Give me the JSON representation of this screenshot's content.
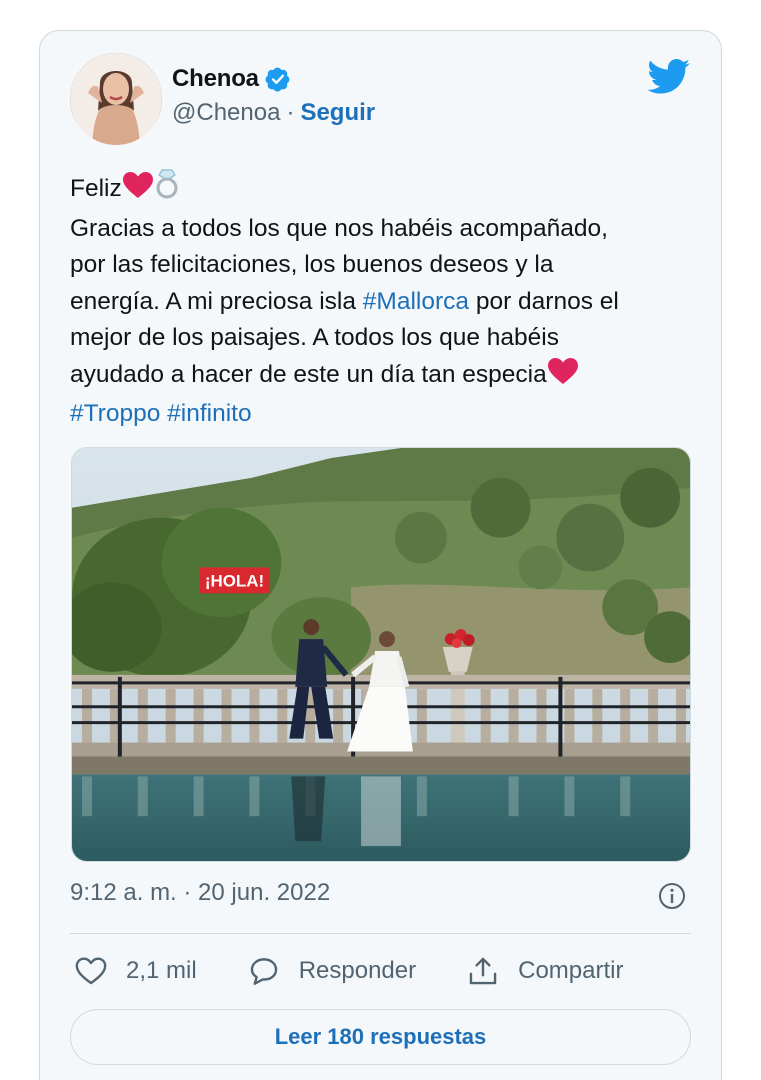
{
  "user": {
    "display_name": "Chenoa",
    "handle": "@Chenoa",
    "separator": "·",
    "follow_label": "Seguir"
  },
  "tweet": {
    "lines": [
      "Feliz",
      "Gracias a todos los que nos habéis acompañado,",
      "por las felicitaciones, los buenos deseos y la",
      "energía. A mi preciosa isla ",
      "#Mallorca",
      " por darnos el",
      "mejor de los paisajes. A todos los que habéis",
      "ayudado a hacer de este un día tan especia"
    ],
    "hashtags": [
      "#Troppo",
      "#infinito"
    ],
    "emojis": [
      "red-heart",
      "ring"
    ]
  },
  "media": {
    "watermark": "¡HOLA!"
  },
  "meta": {
    "timestamp": "9:12 a. m. · 20 jun. 2022"
  },
  "actions": {
    "like_count": "2,1 mil",
    "reply_label": "Responder",
    "share_label": "Compartir"
  },
  "replies_button": "Leer 180 respuestas",
  "colors": {
    "link": "#1d70b8",
    "twitter_blue": "#1d9bf0",
    "muted": "#536471",
    "heart": "#e0245e"
  }
}
